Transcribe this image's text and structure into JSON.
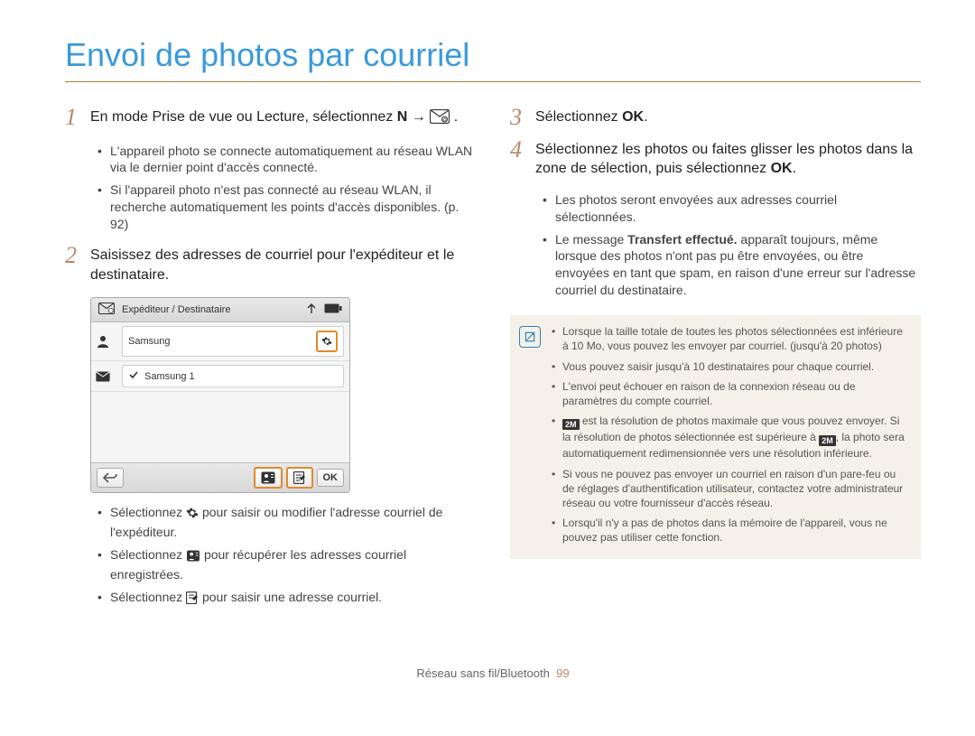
{
  "title": "Envoi de photos par courriel",
  "left": {
    "step1": {
      "num": "1",
      "text_before": "En mode Prise de vue ou Lecture, sélectionnez ",
      "sym": "N",
      "arrow": " → ",
      "period": ".",
      "bullets": [
        "L'appareil photo se connecte automatiquement au réseau WLAN via le dernier point d'accès connecté.",
        "Si l'appareil photo n'est pas connecté au réseau WLAN, il recherche automatiquement les points d'accès disponibles. (p. 92)"
      ]
    },
    "step2": {
      "num": "2",
      "text": "Saisissez des adresses de courriel pour l'expéditeur et le destinataire."
    },
    "camera": {
      "header_label": "Expéditeur / Destinataire",
      "from": "Samsung",
      "to": "Samsung 1",
      "ok": "OK"
    },
    "subbullets": {
      "b1_pre": "Sélectionnez ",
      "b1_post": " pour saisir ou modifier l'adresse courriel de l'expéditeur.",
      "b2_pre": "Sélectionnez ",
      "b2_post": " pour récupérer les adresses courriel enregistrées.",
      "b3_pre": "Sélectionnez ",
      "b3_post": " pour saisir une adresse courriel."
    }
  },
  "right": {
    "step3": {
      "num": "3",
      "pre": "Sélectionnez ",
      "bold": "OK",
      "post": "."
    },
    "step4": {
      "num": "4",
      "pre": "Sélectionnez les photos ou faites glisser les photos dans la zone de sélection, puis sélectionnez ",
      "bold": "OK",
      "post": ".",
      "bullets_html": {
        "b1": "Les photos seront envoyées aux adresses courriel sélectionnées.",
        "b2_pre": "Le message ",
        "b2_bold": "Transfert effectué.",
        "b2_post": " apparaît toujours, même lorsque des photos n'ont pas pu être envoyées, ou être envoyées en tant que spam, en raison d'une erreur sur l'adresse courriel du destinataire."
      }
    },
    "notebox": {
      "n1": "Lorsque la taille totale de toutes les photos sélectionnées est inférieure à 10 Mo, vous pouvez les envoyer par courriel. (jusqu'à 20 photos)",
      "n2": "Vous pouvez saisir jusqu'à 10 destinataires pour chaque courriel.",
      "n3": "L'envoi peut échouer en raison de la connexion réseau ou de paramètres du compte courriel.",
      "n4_pre": "",
      "n4_icon_pre": " est la résolution de photos maximale que vous pouvez envoyer. Si la résolution de photos sélectionnée est supérieure à ",
      "n4_post": ", la photo sera automatiquement redimensionnée vers une résolution inférieure.",
      "n5": "Si vous ne pouvez pas envoyer un courriel en raison d'un pare-feu ou de réglages d'authentification utilisateur, contactez votre administrateur réseau ou votre fournisseur d'accès réseau.",
      "n6": "Lorsqu'il n'y a pas de photos dans la mémoire de l'appareil, vous ne pouvez pas utiliser cette fonction."
    }
  },
  "pager": {
    "section": "Réseau sans fil/Bluetooth",
    "page": "99"
  }
}
